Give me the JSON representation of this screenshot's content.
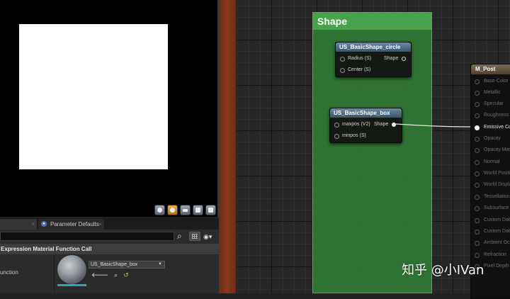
{
  "viewport": {
    "toolbar_icons": [
      "cylinder-icon",
      "sphere-icon",
      "plane-icon",
      "cube-icon",
      "custom-mesh-icon"
    ]
  },
  "details": {
    "tab_details_label": "",
    "tab_params_label": "Parameter Defaults",
    "section_title": "Expression Material Function Call",
    "property_label": "unction",
    "asset_name": "US_BasicShape_box"
  },
  "graph": {
    "comment_title": "Shape",
    "comment_color": "#47a34a",
    "node_circle": {
      "title": "US_BasicShape_circle",
      "inputs": [
        "Radius (S)",
        "Center (S)"
      ],
      "output": "Shape"
    },
    "node_box": {
      "title": "US_BasicShape_box",
      "inputs": [
        "maxpos (V2)",
        "minpos (S)"
      ],
      "output": "Shape"
    },
    "material_node": {
      "title": "M_Post",
      "pins": [
        "Base Color",
        "Metallic",
        "Specular",
        "Roughness",
        "Emissive Color",
        "Opacity",
        "Opacity Mask",
        "Normal",
        "World Position Offset",
        "World Displacement",
        "Tessellation Multiplier",
        "Subsurface Color",
        "Custom Data 0",
        "Custom Data 1",
        "Ambient Occlusion",
        "Refraction",
        "Pixel Depth Offset"
      ],
      "active_pin": "Emissive Color"
    }
  },
  "watermark": "知乎 @小IVan"
}
